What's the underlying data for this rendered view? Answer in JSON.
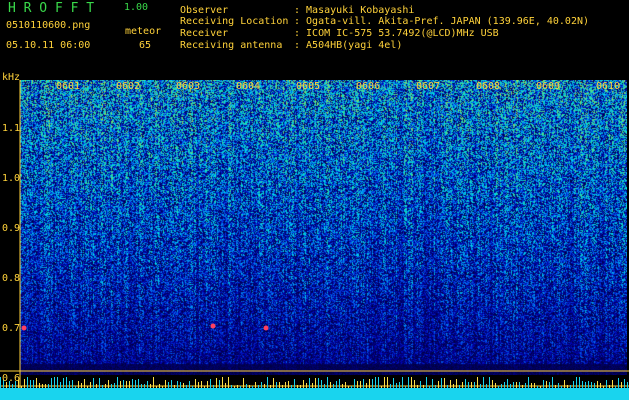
{
  "header": {
    "app_title": "H R O F F T",
    "version": "1.00",
    "filename": "0510110600.png",
    "datetime": "05.10.11 06:00",
    "meteor_label": "meteor",
    "meteor_count": "65"
  },
  "info": [
    {
      "label": "Observer",
      "value": ": Masayuki Kobayashi"
    },
    {
      "label": "Receiving Location",
      "value": ": Ogata-vill. Akita-Pref. JAPAN (139.96E, 40.02N)"
    },
    {
      "label": "Receiver",
      "value": ": ICOM IC-575 53.7492(@LCD)MHz USB"
    },
    {
      "label": "Receiving antenna",
      "value": ": A504HB(yagi 4el)"
    }
  ],
  "axis": {
    "unit": "kHz",
    "y_ticks": [
      "1.1",
      "1.0",
      "0.9",
      "0.8",
      "0.7",
      "0.6"
    ],
    "x_ticks": [
      "0601",
      "0602",
      "0603",
      "0604",
      "0605",
      "0606",
      "0607",
      "0608",
      "0609",
      "0610"
    ]
  },
  "colors": {
    "text": "#ffd23a",
    "title": "#39d94a",
    "noise_floor": "#19d4ee",
    "meteor_echo": "#ff4060"
  }
}
